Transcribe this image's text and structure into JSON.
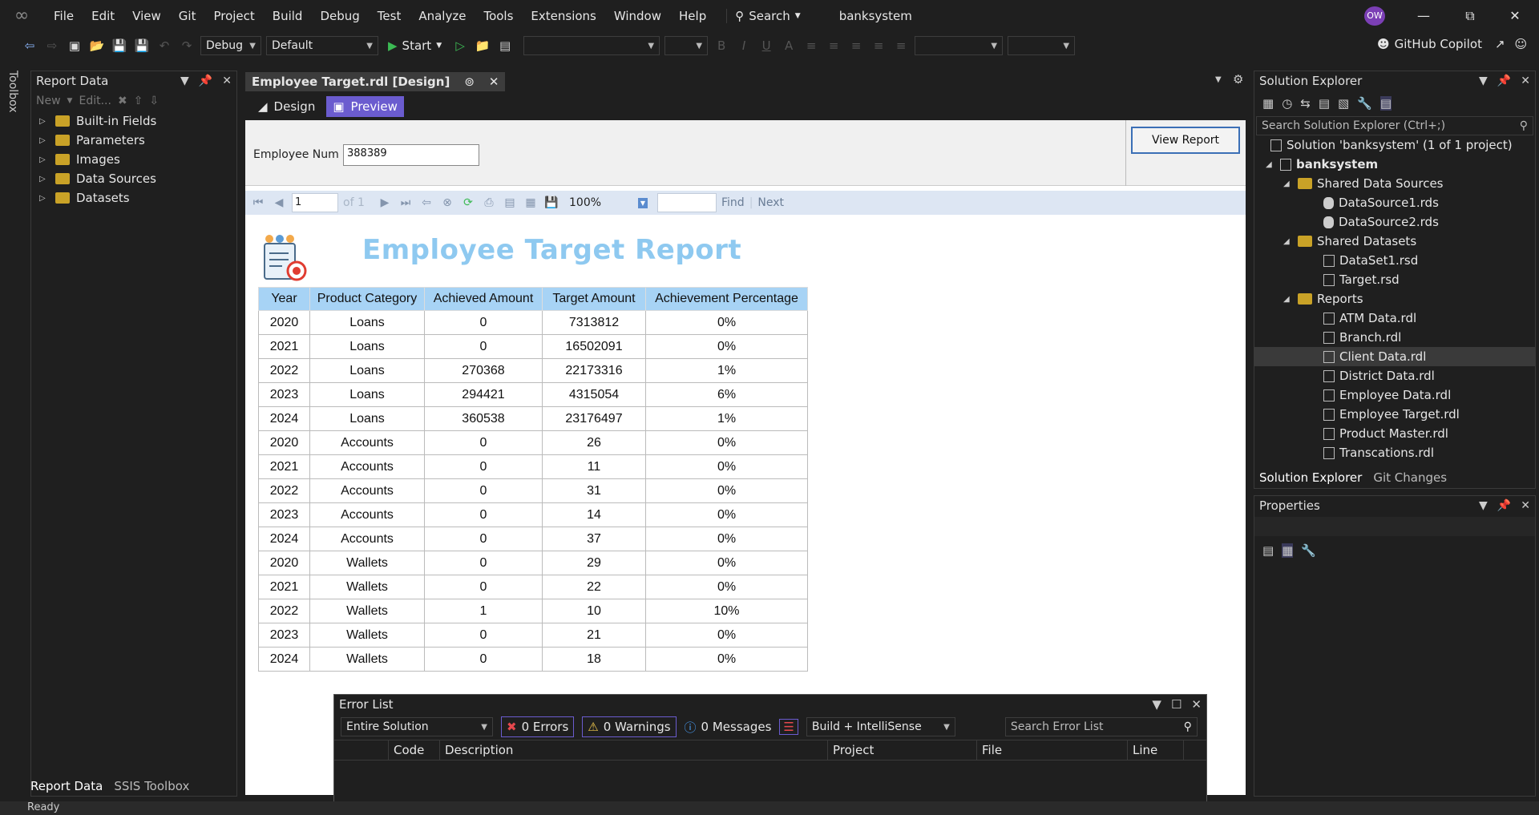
{
  "menu": [
    "File",
    "Edit",
    "View",
    "Git",
    "Project",
    "Build",
    "Debug",
    "Test",
    "Analyze",
    "Tools",
    "Extensions",
    "Window",
    "Help"
  ],
  "search_label": "Search",
  "solution_name": "banksystem",
  "user_initials": "OW",
  "toolbar": {
    "config": "Debug",
    "platform": "Default",
    "start_label": "Start",
    "copilot_label": "GitHub Copilot"
  },
  "toolbox_label": "Toolbox",
  "report_data": {
    "title": "Report Data",
    "new_label": "New",
    "edit_label": "Edit...",
    "items": [
      "Built-in Fields",
      "Parameters",
      "Images",
      "Data Sources",
      "Datasets"
    ],
    "bottom_tabs": [
      "Report Data",
      "SSIS Toolbox"
    ]
  },
  "doc_tab": "Employee Target.rdl [Design]",
  "modes": {
    "design": "Design",
    "preview": "Preview"
  },
  "params": {
    "label": "Employee Num",
    "value": "388389",
    "view_button": "View Report"
  },
  "viewer": {
    "page": "1",
    "of": "of 1",
    "zoom": "100%",
    "find": "Find",
    "next": "Next"
  },
  "report": {
    "title": "Employee Target Report",
    "columns": [
      "Year",
      "Product Category",
      "Achieved Amount",
      "Target Amount",
      "Achievement Percentage"
    ],
    "rows": [
      [
        "2020",
        "Loans",
        "0",
        "7313812",
        "0%"
      ],
      [
        "2021",
        "Loans",
        "0",
        "16502091",
        "0%"
      ],
      [
        "2022",
        "Loans",
        "270368",
        "22173316",
        "1%"
      ],
      [
        "2023",
        "Loans",
        "294421",
        "4315054",
        "6%"
      ],
      [
        "2024",
        "Loans",
        "360538",
        "23176497",
        "1%"
      ],
      [
        "2020",
        "Accounts",
        "0",
        "26",
        "0%"
      ],
      [
        "2021",
        "Accounts",
        "0",
        "11",
        "0%"
      ],
      [
        "2022",
        "Accounts",
        "0",
        "31",
        "0%"
      ],
      [
        "2023",
        "Accounts",
        "0",
        "14",
        "0%"
      ],
      [
        "2024",
        "Accounts",
        "0",
        "37",
        "0%"
      ],
      [
        "2020",
        "Wallets",
        "0",
        "29",
        "0%"
      ],
      [
        "2021",
        "Wallets",
        "0",
        "22",
        "0%"
      ],
      [
        "2022",
        "Wallets",
        "1",
        "10",
        "10%"
      ],
      [
        "2023",
        "Wallets",
        "0",
        "21",
        "0%"
      ],
      [
        "2024",
        "Wallets",
        "0",
        "18",
        "0%"
      ]
    ]
  },
  "solution_explorer": {
    "title": "Solution Explorer",
    "search_placeholder": "Search Solution Explorer (Ctrl+;)",
    "solution_label": "Solution 'banksystem' (1 of 1 project)",
    "project": "banksystem",
    "folders": {
      "shared_sources": "Shared Data Sources",
      "shared_datasets": "Shared Datasets",
      "reports": "Reports"
    },
    "data_sources": [
      "DataSource1.rds",
      "DataSource2.rds"
    ],
    "datasets": [
      "DataSet1.rsd",
      "Target.rsd"
    ],
    "reports": [
      "ATM Data.rdl",
      "Branch.rdl",
      "Client Data.rdl",
      "District Data.rdl",
      "Employee Data.rdl",
      "Employee Target.rdl",
      "Product Master.rdl",
      "Transcations.rdl"
    ],
    "selected_report": "Client Data.rdl",
    "tabs": [
      "Solution Explorer",
      "Git Changes"
    ]
  },
  "properties_title": "Properties",
  "error_list": {
    "title": "Error List",
    "scope": "Entire Solution",
    "errors": "0 Errors",
    "warnings": "0 Warnings",
    "messages": "0 Messages",
    "build": "Build + IntelliSense",
    "search_placeholder": "Search Error List",
    "columns": [
      "Code",
      "Description",
      "Project",
      "File",
      "Line"
    ]
  },
  "status": "Ready"
}
